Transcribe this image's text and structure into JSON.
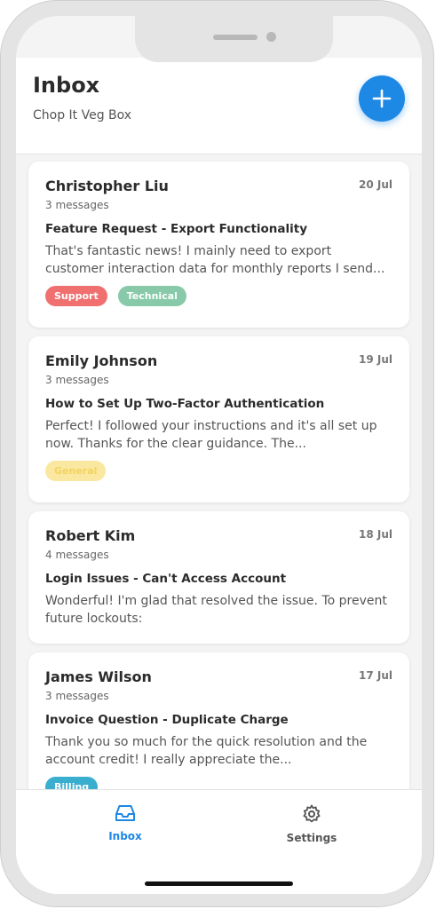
{
  "header": {
    "title": "Inbox",
    "subtitle": "Chop It Veg Box",
    "compose_icon": "plus-icon"
  },
  "conversations": [
    {
      "sender": "Christopher Liu",
      "count": "3 messages",
      "date": "20 Jul",
      "subject": "Feature Request - Export Functionality",
      "preview": "That's fantastic news! I mainly need to export customer interaction data for monthly reports I send...",
      "tags": [
        "Support",
        "Technical"
      ]
    },
    {
      "sender": "Emily Johnson",
      "count": "3 messages",
      "date": "19 Jul",
      "subject": "How to Set Up Two-Factor Authentication",
      "preview": "Perfect! I followed your instructions and it's all set up now. Thanks for the clear guidance. The...",
      "tags": [
        "General"
      ]
    },
    {
      "sender": "Robert Kim",
      "count": "4 messages",
      "date": "18 Jul",
      "subject": "Login Issues - Can't Access Account",
      "preview": "Wonderful! I'm glad that resolved the issue. To prevent future lockouts:",
      "tags": []
    },
    {
      "sender": "James Wilson",
      "count": "3 messages",
      "date": "17 Jul",
      "subject": "Invoice Question - Duplicate Charge",
      "preview": "Thank you so much for the quick resolution and the account credit! I really appreciate the...",
      "tags": [
        "Billing"
      ]
    }
  ],
  "tabbar": {
    "inbox_label": "Inbox",
    "settings_label": "Settings",
    "inbox_icon": "inbox-icon",
    "settings_icon": "gear-icon"
  },
  "colors": {
    "accent": "#1e88e5",
    "support": "#f07070",
    "technical": "#87c9a8",
    "general": "#fbe8a0",
    "billing": "#3aaecf"
  }
}
